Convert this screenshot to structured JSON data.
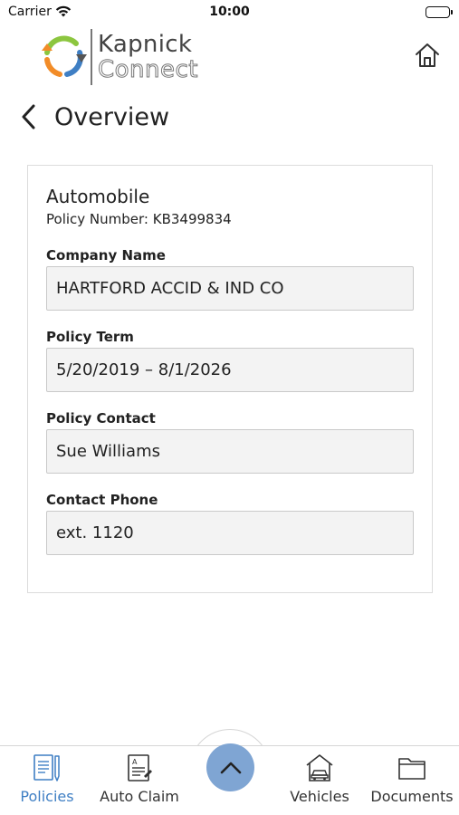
{
  "status_bar": {
    "carrier": "Carrier",
    "time": "10:00"
  },
  "header": {
    "logo_line1": "Kapnick",
    "logo_line2": "Connect",
    "home_icon": "home-icon"
  },
  "page": {
    "title": "Overview",
    "back_icon": "chevron-left-icon"
  },
  "policy": {
    "type": "Automobile",
    "number_text": "Policy Number: KB3499834",
    "fields": [
      {
        "label": "Company Name",
        "value": "HARTFORD ACCID & IND CO"
      },
      {
        "label": "Policy Term",
        "value": "5/20/2019 – 8/1/2026"
      },
      {
        "label": "Policy Contact",
        "value": "Sue Williams"
      },
      {
        "label": "Contact Phone",
        "value": "ext. 1120"
      }
    ]
  },
  "tab_bar": {
    "items": [
      {
        "label": "Policies",
        "icon": "policies-icon",
        "active": true
      },
      {
        "label": "Auto Claim",
        "icon": "auto-claim-icon",
        "active": false
      },
      {
        "label": "Vehicles",
        "icon": "vehicles-icon",
        "active": false
      },
      {
        "label": "Documents",
        "icon": "documents-icon",
        "active": false
      }
    ],
    "center_icon": "chevron-up-icon"
  },
  "colors": {
    "accent": "#3f7fc4",
    "center_button": "#7fa5d3",
    "logo_green": "#8cc63f",
    "logo_orange": "#f28c28",
    "logo_blue": "#3f7fc4"
  }
}
